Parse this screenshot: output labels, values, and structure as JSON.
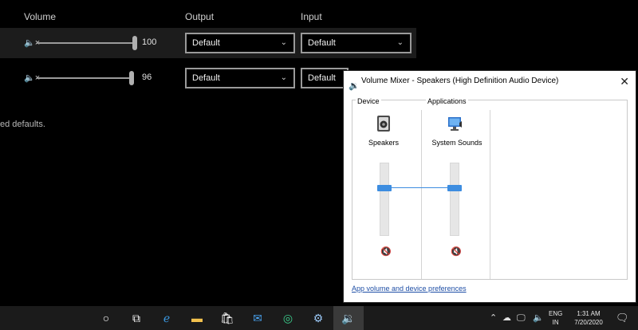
{
  "settings": {
    "headers": {
      "volume": "Volume",
      "output": "Output",
      "input": "Input"
    },
    "rows": [
      {
        "mute_icon": "🔈×",
        "volume": 100,
        "volume_label": "100",
        "output": "Default",
        "input": "Default"
      },
      {
        "mute_icon": "🔈×",
        "volume": 96,
        "volume_label": "96",
        "output": "Default",
        "input": "Default"
      }
    ],
    "restore_tail": "ed defaults."
  },
  "mixer": {
    "title": "Volume Mixer - Speakers (High Definition Audio Device)",
    "close": "✕",
    "device_group": "Device",
    "apps_group": "Applications",
    "device_name": "Speakers",
    "app_name": "System Sounds",
    "link": "App volume and device preferences",
    "accent": "#3d8de0"
  },
  "taskbar": {
    "icons": [
      "cortana-circle-icon",
      "task-view-icon",
      "edge-icon",
      "file-explorer-icon",
      "store-icon",
      "mail-icon",
      "photos-icon",
      "settings-gear-icon",
      "volume-mixer-icon"
    ],
    "lang_top": "ENG",
    "lang_bottom": "IN",
    "time": "1:31 AM",
    "date": "7/20/2020"
  }
}
